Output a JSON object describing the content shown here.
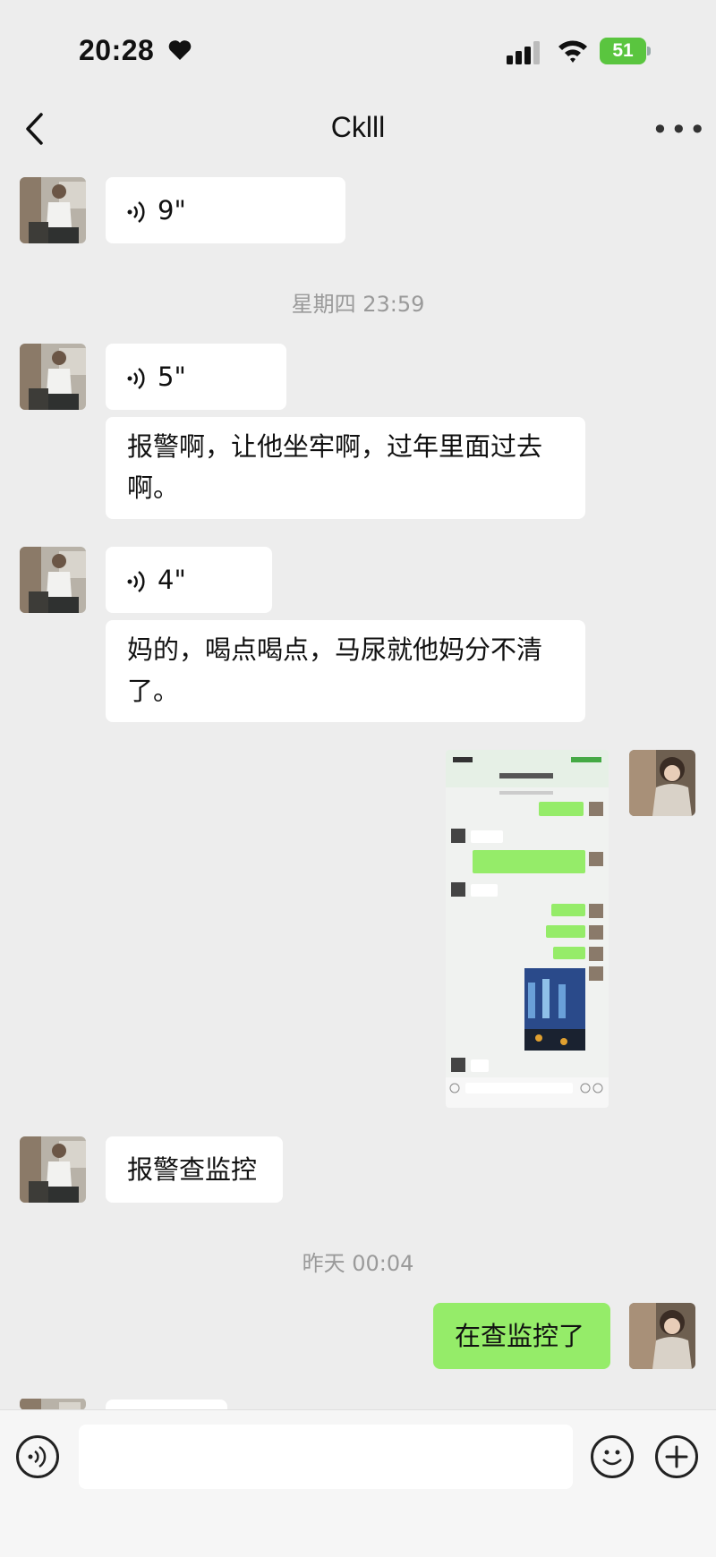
{
  "status": {
    "time": "20:28",
    "battery": "51"
  },
  "chat": {
    "title": "Cklll"
  },
  "messages": {
    "voice1": "9\"",
    "ts1": "星期四 23:59",
    "voice2": "5\"",
    "text1_line1": "报警啊，让他坐牢啊，过年里面过去",
    "text1_line2": "啊。",
    "voice3": "4\"",
    "text2_line1": "妈的，喝点喝点，马尿就他妈分不清",
    "text2_line2": "了。",
    "text3": "报警查监控",
    "ts2": "昨天 00:04",
    "text4": "在查监控了"
  },
  "icons": {
    "back": "chevron-left-icon",
    "more": "more-icon",
    "voice": "voice-wave-icon",
    "emoji": "emoji-icon",
    "add": "plus-icon",
    "voice_input": "voice-input-icon"
  },
  "colors": {
    "background": "#ededed",
    "sent_bubble": "#95ec69",
    "received_bubble": "#ffffff",
    "battery": "#5ac53f"
  }
}
